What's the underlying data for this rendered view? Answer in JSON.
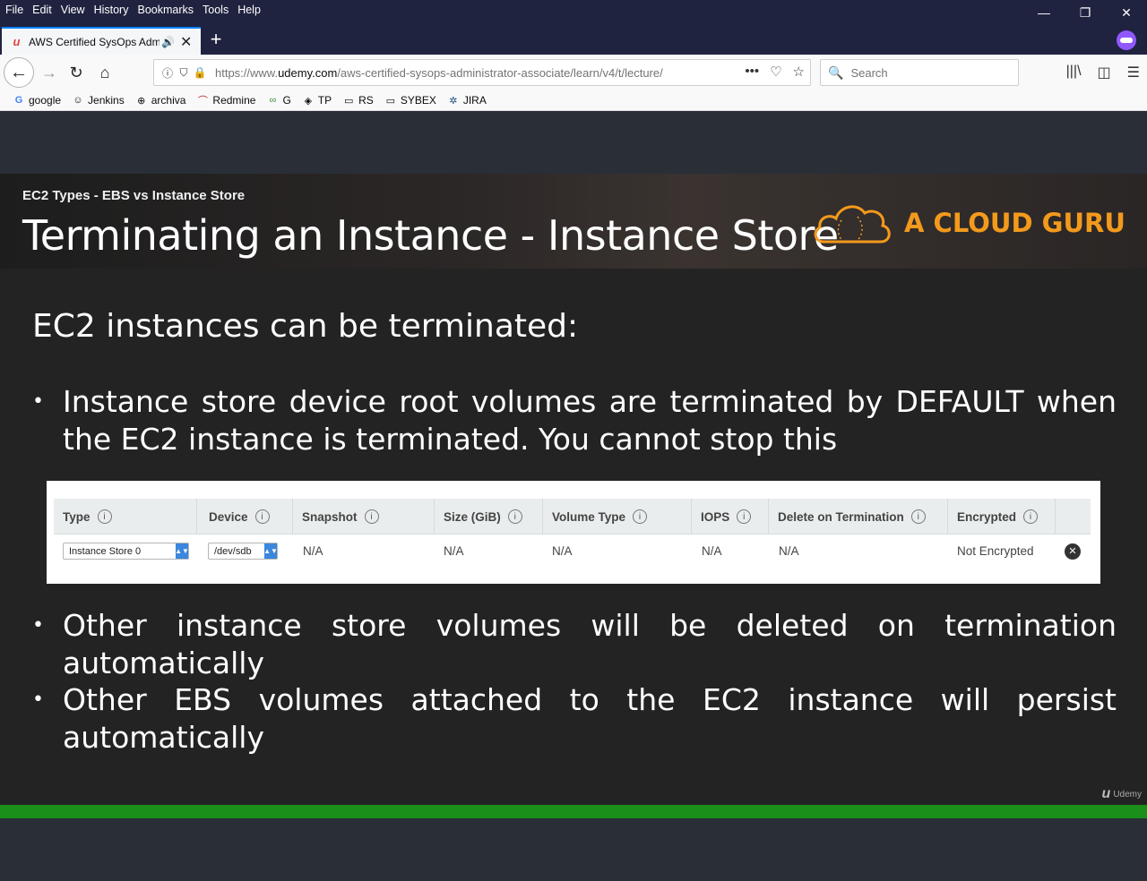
{
  "browser": {
    "menu": [
      "File",
      "Edit",
      "View",
      "History",
      "Bookmarks",
      "Tools",
      "Help"
    ],
    "window_controls": {
      "minimize": "—",
      "restore": "❐",
      "close": "✕"
    },
    "tab": {
      "title": "AWS Certified SysOps Admi",
      "favicon": "u",
      "close": "✕"
    },
    "new_tab": "+",
    "url_prefix": "https://www.",
    "url_domain": "udemy.com",
    "url_path": "/aws-certified-sysops-administrator-associate/learn/v4/t/lecture/",
    "search_placeholder": "Search",
    "bookmarks": [
      {
        "label": "google",
        "icon": "G"
      },
      {
        "label": "Jenkins",
        "icon": "☺"
      },
      {
        "label": "archiva",
        "icon": "⊕"
      },
      {
        "label": "Redmine",
        "icon": "⌒"
      },
      {
        "label": "G",
        "icon": "∞"
      },
      {
        "label": "TP",
        "icon": "◈"
      },
      {
        "label": "RS",
        "icon": "▭"
      },
      {
        "label": "SYBEX",
        "icon": "▭"
      },
      {
        "label": "JIRA",
        "icon": "✲"
      }
    ]
  },
  "slide": {
    "kicker": "EC2 Types - EBS vs Instance Store",
    "title": "Terminating an Instance - Instance Store",
    "logo_text": "A CLOUD GURU",
    "heading": "EC2 instances can be terminated:",
    "bullet_mark": "•",
    "bullets": [
      "Instance store device root volumes are terminated by DEFAULT when the EC2 instance is terminated. You cannot stop this",
      "Other instance store volumes will be deleted on termination automatically",
      "Other EBS volumes attached to the EC2 instance will persist automatically"
    ],
    "table": {
      "info_glyph": "i",
      "headers": [
        "Type",
        "Device",
        "Snapshot",
        "Size (GiB)",
        "Volume Type",
        "IOPS",
        "Delete on Termination",
        "Encrypted"
      ],
      "row": {
        "type": "Instance Store 0",
        "device": "/dev/sdb",
        "snapshot": "N/A",
        "size": "N/A",
        "volume_type": "N/A",
        "iops": "N/A",
        "delete_on_termination": "N/A",
        "encrypted": "Not Encrypted",
        "remove": "✕"
      }
    },
    "watermark": "Udemy"
  },
  "colors": {
    "accent": "#f39a1c",
    "progress": "#1a8f1a",
    "tab_highlight": "#0a84ff",
    "private_badge": "#9059ff"
  }
}
